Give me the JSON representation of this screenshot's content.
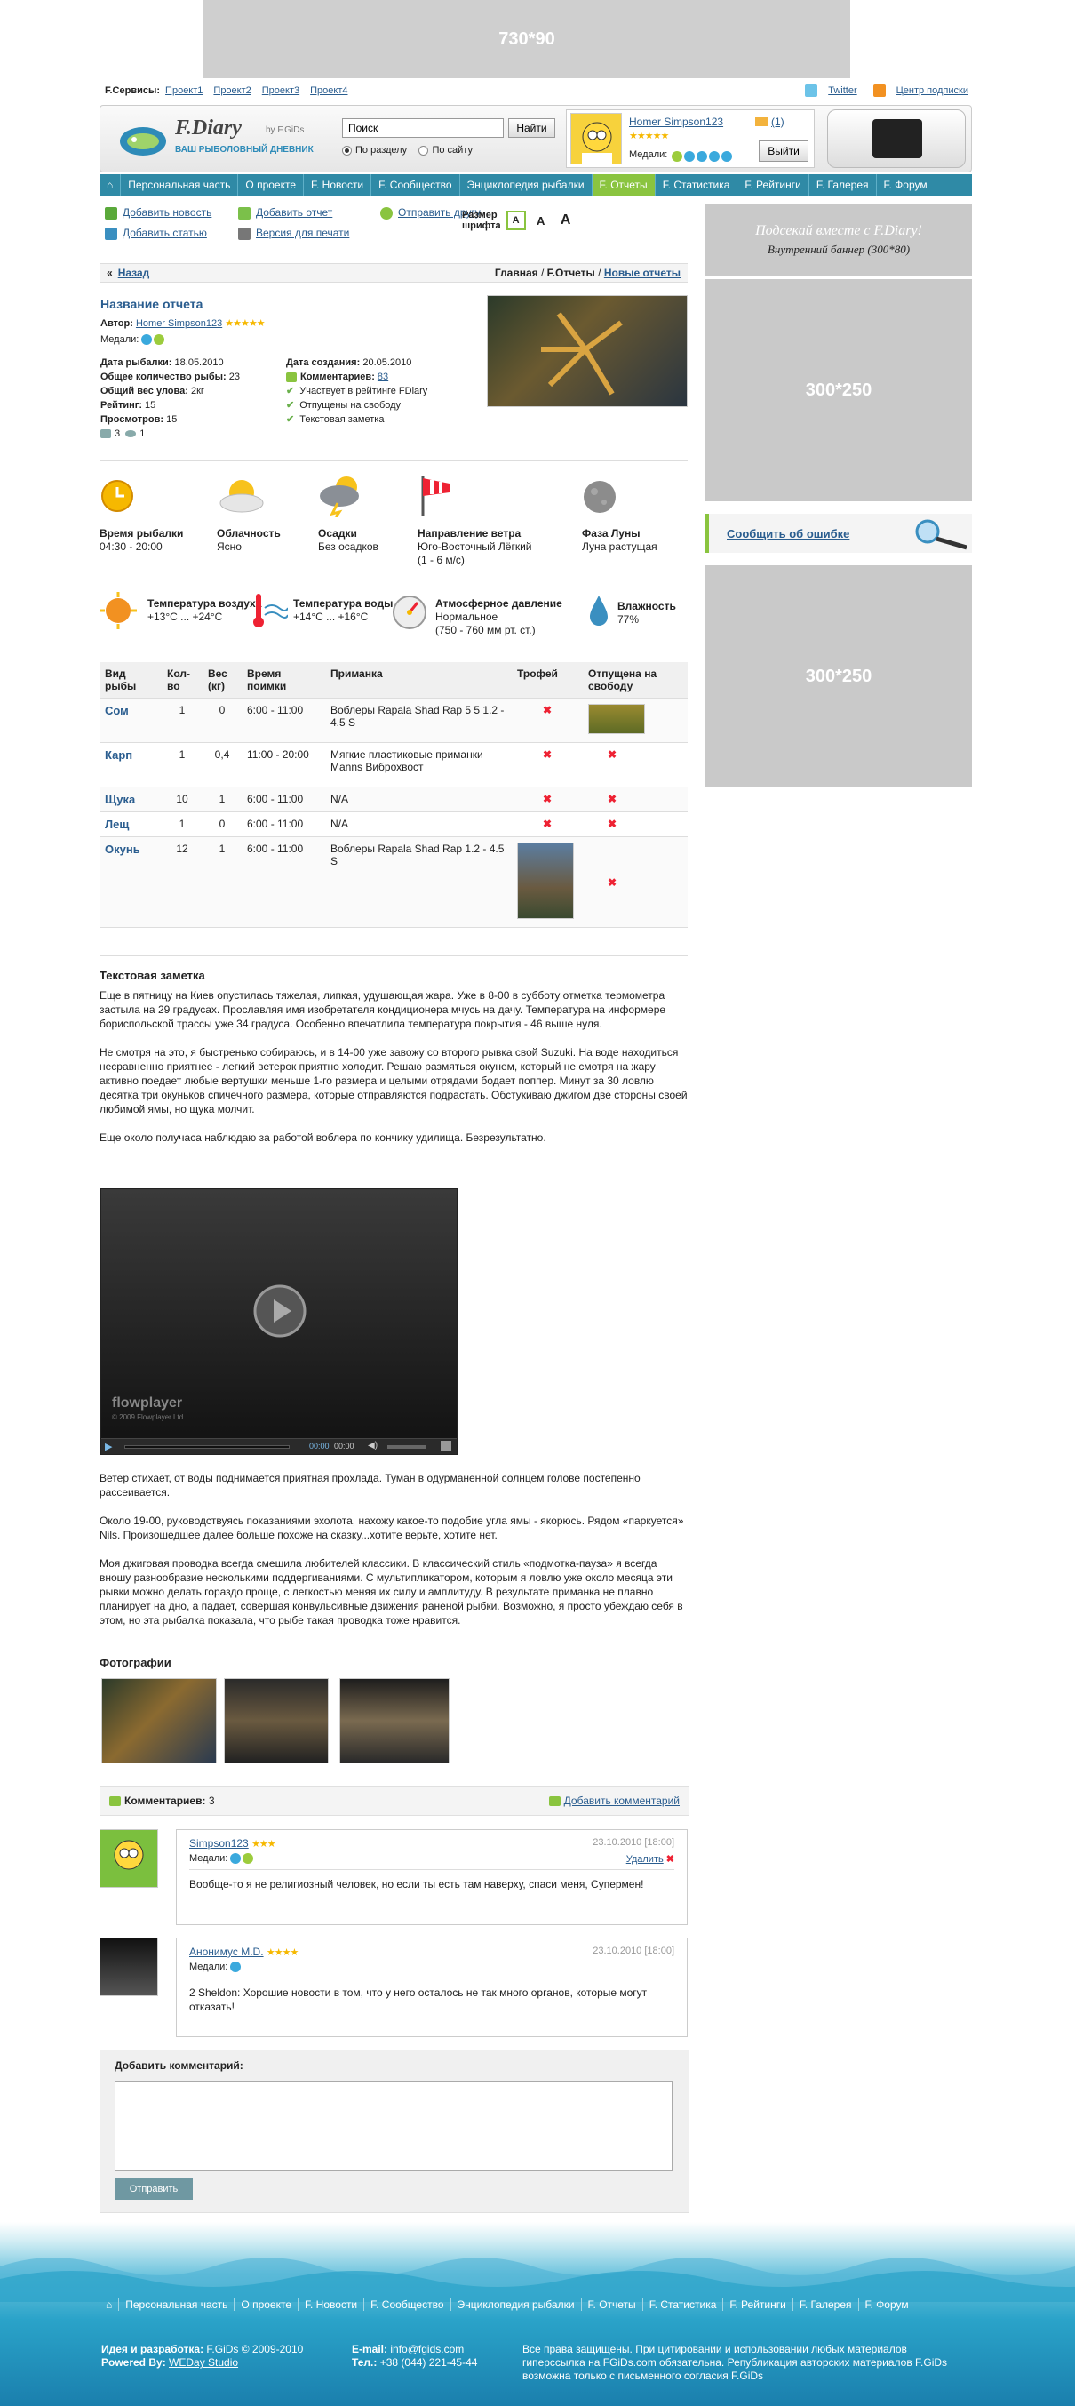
{
  "banners": {
    "top": "730*90",
    "right1": "300*250",
    "right2": "300*250",
    "promo_title": "Подсекай вместе с F.Diary!",
    "promo_sub": "Внутренний баннер (300*80)"
  },
  "services": {
    "label": "F.Сервисы:",
    "items": [
      "Проект1",
      "Проект2",
      "Проект3",
      "Проект4"
    ],
    "twitter": "Twitter",
    "subscribe": "Центр подписки"
  },
  "logo": {
    "name": "F.Diary",
    "by": "by F.GiDs",
    "tagline": "ВАШ РЫБОЛОВНЫЙ ДНЕВНИК"
  },
  "search": {
    "value": "Поиск",
    "button": "Найти",
    "opt1": "По разделу",
    "opt2": "По сайту"
  },
  "user": {
    "name": "Homer Simpson123",
    "mail_count": "(1)",
    "medals_label": "Медали:",
    "logout": "Выйти"
  },
  "nav": [
    "Персональная часть",
    "О проекте",
    "F. Новости",
    "F. Сообщество",
    "Энциклопедия рыбалки",
    "F. Отчеты",
    "F. Статистика",
    "F. Рейтинги",
    "F. Галерея",
    "F. Форум"
  ],
  "actions": {
    "add_news": "Добавить новость",
    "add_report": "Добавить отчет",
    "send_friend": "Отправить другу",
    "add_article": "Добавить статью",
    "print": "Версия для печати",
    "fontsize_label_1": "Размер",
    "fontsize_label_2": "шрифта",
    "font_a": "A"
  },
  "breadcrumb": {
    "back": "Назад",
    "home": "Главная",
    "section": "F.Отчеты",
    "new": "Новые отчеты",
    "sep": "/"
  },
  "report": {
    "title": "Название отчета",
    "author_label": "Автор:",
    "author": "Homer Simpson123",
    "medals_label": "Медали:",
    "date_fish_label": "Дата рыбалки:",
    "date_fish": "18.05.2010",
    "total_label": "Общее количество рыбы:",
    "total": "23",
    "weight_label": "Общий вес улова:",
    "weight": "2кг",
    "rating_label": "Рейтинг:",
    "rating": "15",
    "views_label": "Просмотров:",
    "views": "15",
    "photos_count": "3",
    "views_icon_count": "1",
    "date_created_label": "Дата создания:",
    "date_created": "20.05.2010",
    "comments_label": "Комментариев:",
    "comments": "83",
    "checks": [
      "Участвует в рейтинге FDiary",
      "Отпущены на свободу",
      "Текстовая заметка"
    ]
  },
  "weather": [
    {
      "title": "Время рыбалки",
      "value": "04:30 - 20:00"
    },
    {
      "title": "Облачность",
      "value": "Ясно"
    },
    {
      "title": "Осадки",
      "value": "Без осадков"
    },
    {
      "title": "Направление ветра",
      "value": "Юго-Восточный Лёгкий",
      "value2": "(1 - 6 м/с)"
    },
    {
      "title": "Фаза Луны",
      "value": "Луна растущая"
    },
    {
      "title": "Температура воздуха",
      "value": "+13°C ... +24°C"
    },
    {
      "title": "Температура воды",
      "value": "+14°C ... +16°C"
    },
    {
      "title": "Атмосферное давление",
      "value": "Нормальное",
      "value2": "(750 - 760 мм рт. ст.)"
    },
    {
      "title": "Влажность",
      "value": "77%"
    }
  ],
  "table": {
    "headers": [
      "Вид рыбы",
      "Кол-во",
      "Вес (кг)",
      "Время поимки",
      "Приманка",
      "Трофей",
      "Отпущена на свободу"
    ],
    "rows": [
      [
        "Сом",
        "1",
        "0",
        "6:00 - 11:00",
        "Воблеры Rapala Shad Rap 5 5 1.2 - 4.5 S"
      ],
      [
        "Карп",
        "1",
        "0,4",
        "11:00 - 20:00",
        "Мягкие пластиковые приманки Manns Виброхвост"
      ],
      [
        "Щука",
        "10",
        "1",
        "6:00 - 11:00",
        "N/A"
      ],
      [
        "Лещ",
        "1",
        "0",
        "6:00 - 11:00",
        "N/A"
      ],
      [
        "Окунь",
        "12",
        "1",
        "6:00 - 11:00",
        "Воблеры Rapala Shad Rap 1.2 - 4.5 S"
      ]
    ]
  },
  "notes": {
    "title": "Текстовая заметка",
    "p1": "Еще в пятницу на Киев опустилась тяжелая, липкая, удушающая жара. Уже в 8-00 в субботу отметка термометра застыла на 29 градусах. Прославляя имя изобретателя кондиционера мчусь на дачу. Температура на информере бориспольской трассы уже 34 градуса. Особенно впечатлила температура покрытия - 46 выше нуля.",
    "p2": "Не смотря на это, я быстренько собираюсь, и в 14-00 уже завожу со второго рывка свой Suzuki. На воде находиться несравненно приятнее - легкий ветерок приятно холодит. Решаю размяться окунем, который не смотря на жару активно поедает любые вертушки меньше 1-го размера и целыми отрядами бодает поппер. Минут за 30 ловлю десятка три окуньков спичечного размера, которые отправляются подрастать. Обстукиваю джигом две стороны своей любимой ямы, но щука молчит.",
    "p3": "Еще около получаса наблюдаю за работой воблера по кончику удилища. Безрезультатно.",
    "p4": "Ветер стихает, от воды поднимается приятная прохлада. Туман в одурманенной солнцем голове постепенно рассеивается.",
    "p5": "Около 19-00, руководствуясь показаниями эхолота, нахожу какое-то подобие угла ямы - якорюсь. Рядом «паркуется» Nils. Произошедшее далее больше похоже на сказку...хотите верьте, хотите нет.",
    "p6": "Моя джиговая проводка всегда смешила любителей классики. В классический стиль «подмотка-пауза» я всегда вношу разнообразие несколькими поддергиваниями. С мультипликатором, которым я ловлю уже около месяца эти рывки можно делать гораздо проще, с легкостью меняя их силу и амплитуду. В результате приманка не плавно планирует на дно, а падает, совершая конвульсивные движения раненой рыбки. Возможно, я просто убеждаю себя в этом, но эта рыбалка показала, что рыбе такая проводка тоже нравится."
  },
  "player": {
    "brand": "flowplayer",
    "copyright": "© 2009 Flowplayer Ltd",
    "time_cur": "00:00",
    "time_total": "00:00"
  },
  "photos_title": "Фотографии",
  "comments": {
    "label": "Комментариев:",
    "count": "3",
    "add": "Добавить комментарий",
    "items": [
      {
        "name": "Simpson123",
        "date": "23.10.2010 [18:00]",
        "medals": "Медали:",
        "delete": "Удалить",
        "text": "Вообще-то я не религиозный человек, но если ты есть там наверху, спаси меня, Супермен!"
      },
      {
        "name": "Анонимус M.D.",
        "date": "23.10.2010 [18:00]",
        "medals": "Медали:",
        "text": "2 Sheldon: Хорошие новости в том, что у него осталось не так много органов, которые могут отказать!"
      }
    ],
    "form_title": "Добавить комментарий:",
    "submit": "Отправить"
  },
  "right": {
    "report_error": "Сообщить об ошибке"
  },
  "footer": {
    "nav": [
      "Персональная часть",
      "О проекте",
      "F. Новости",
      "F. Сообщество",
      "Энциклопедия рыбалки",
      "F. Отчеты",
      "F. Статистика",
      "F. Рейтинги",
      "F. Галерея",
      "F. Форум"
    ],
    "idea_label": "Идея и разработка:",
    "idea": "F.GiDs © 2009-2010",
    "powered_label": "Powered By:",
    "powered": "WEDay Studio",
    "email_label": "E-mail:",
    "email": "info@fgids.com",
    "tel_label": "Тел.:",
    "tel": "+38 (044) 221-45-44",
    "rights": "Все права защищены. При цитировании и использовании любых материалов гиперссылка на FGiDs.com обязательна. Републикация авторских материалов F.GiDs возможна только с письменного согласия F.GiDs"
  },
  "colors": {
    "nav": "#2f8aa6",
    "nav_active": "#8ac43f",
    "link": "#2a5d8f",
    "banner": "#c9c9c9"
  }
}
